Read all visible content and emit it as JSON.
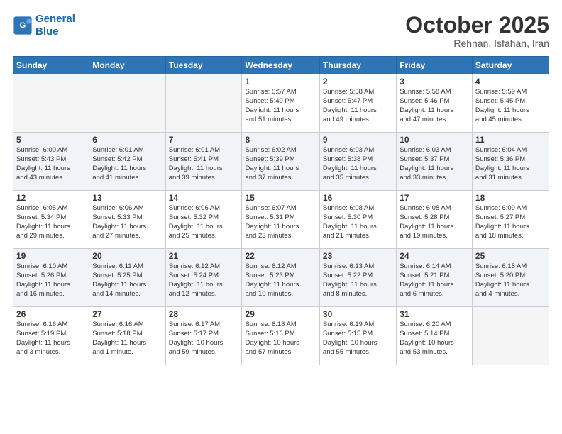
{
  "header": {
    "logo_line1": "General",
    "logo_line2": "Blue",
    "month": "October 2025",
    "location": "Rehnan, Isfahan, Iran"
  },
  "weekdays": [
    "Sunday",
    "Monday",
    "Tuesday",
    "Wednesday",
    "Thursday",
    "Friday",
    "Saturday"
  ],
  "weeks": [
    [
      {
        "day": "",
        "info": ""
      },
      {
        "day": "",
        "info": ""
      },
      {
        "day": "",
        "info": ""
      },
      {
        "day": "1",
        "info": "Sunrise: 5:57 AM\nSunset: 5:49 PM\nDaylight: 11 hours\nand 51 minutes."
      },
      {
        "day": "2",
        "info": "Sunrise: 5:58 AM\nSunset: 5:47 PM\nDaylight: 11 hours\nand 49 minutes."
      },
      {
        "day": "3",
        "info": "Sunrise: 5:58 AM\nSunset: 5:46 PM\nDaylight: 11 hours\nand 47 minutes."
      },
      {
        "day": "4",
        "info": "Sunrise: 5:59 AM\nSunset: 5:45 PM\nDaylight: 11 hours\nand 45 minutes."
      }
    ],
    [
      {
        "day": "5",
        "info": "Sunrise: 6:00 AM\nSunset: 5:43 PM\nDaylight: 11 hours\nand 43 minutes."
      },
      {
        "day": "6",
        "info": "Sunrise: 6:01 AM\nSunset: 5:42 PM\nDaylight: 11 hours\nand 41 minutes."
      },
      {
        "day": "7",
        "info": "Sunrise: 6:01 AM\nSunset: 5:41 PM\nDaylight: 11 hours\nand 39 minutes."
      },
      {
        "day": "8",
        "info": "Sunrise: 6:02 AM\nSunset: 5:39 PM\nDaylight: 11 hours\nand 37 minutes."
      },
      {
        "day": "9",
        "info": "Sunrise: 6:03 AM\nSunset: 5:38 PM\nDaylight: 11 hours\nand 35 minutes."
      },
      {
        "day": "10",
        "info": "Sunrise: 6:03 AM\nSunset: 5:37 PM\nDaylight: 11 hours\nand 33 minutes."
      },
      {
        "day": "11",
        "info": "Sunrise: 6:04 AM\nSunset: 5:36 PM\nDaylight: 11 hours\nand 31 minutes."
      }
    ],
    [
      {
        "day": "12",
        "info": "Sunrise: 6:05 AM\nSunset: 5:34 PM\nDaylight: 11 hours\nand 29 minutes."
      },
      {
        "day": "13",
        "info": "Sunrise: 6:06 AM\nSunset: 5:33 PM\nDaylight: 11 hours\nand 27 minutes."
      },
      {
        "day": "14",
        "info": "Sunrise: 6:06 AM\nSunset: 5:32 PM\nDaylight: 11 hours\nand 25 minutes."
      },
      {
        "day": "15",
        "info": "Sunrise: 6:07 AM\nSunset: 5:31 PM\nDaylight: 11 hours\nand 23 minutes."
      },
      {
        "day": "16",
        "info": "Sunrise: 6:08 AM\nSunset: 5:30 PM\nDaylight: 11 hours\nand 21 minutes."
      },
      {
        "day": "17",
        "info": "Sunrise: 6:08 AM\nSunset: 5:28 PM\nDaylight: 11 hours\nand 19 minutes."
      },
      {
        "day": "18",
        "info": "Sunrise: 6:09 AM\nSunset: 5:27 PM\nDaylight: 11 hours\nand 18 minutes."
      }
    ],
    [
      {
        "day": "19",
        "info": "Sunrise: 6:10 AM\nSunset: 5:26 PM\nDaylight: 11 hours\nand 16 minutes."
      },
      {
        "day": "20",
        "info": "Sunrise: 6:11 AM\nSunset: 5:25 PM\nDaylight: 11 hours\nand 14 minutes."
      },
      {
        "day": "21",
        "info": "Sunrise: 6:12 AM\nSunset: 5:24 PM\nDaylight: 11 hours\nand 12 minutes."
      },
      {
        "day": "22",
        "info": "Sunrise: 6:12 AM\nSunset: 5:23 PM\nDaylight: 11 hours\nand 10 minutes."
      },
      {
        "day": "23",
        "info": "Sunrise: 6:13 AM\nSunset: 5:22 PM\nDaylight: 11 hours\nand 8 minutes."
      },
      {
        "day": "24",
        "info": "Sunrise: 6:14 AM\nSunset: 5:21 PM\nDaylight: 11 hours\nand 6 minutes."
      },
      {
        "day": "25",
        "info": "Sunrise: 6:15 AM\nSunset: 5:20 PM\nDaylight: 11 hours\nand 4 minutes."
      }
    ],
    [
      {
        "day": "26",
        "info": "Sunrise: 6:16 AM\nSunset: 5:19 PM\nDaylight: 11 hours\nand 3 minutes."
      },
      {
        "day": "27",
        "info": "Sunrise: 6:16 AM\nSunset: 5:18 PM\nDaylight: 11 hours\nand 1 minute."
      },
      {
        "day": "28",
        "info": "Sunrise: 6:17 AM\nSunset: 5:17 PM\nDaylight: 10 hours\nand 59 minutes."
      },
      {
        "day": "29",
        "info": "Sunrise: 6:18 AM\nSunset: 5:16 PM\nDaylight: 10 hours\nand 57 minutes."
      },
      {
        "day": "30",
        "info": "Sunrise: 6:19 AM\nSunset: 5:15 PM\nDaylight: 10 hours\nand 55 minutes."
      },
      {
        "day": "31",
        "info": "Sunrise: 6:20 AM\nSunset: 5:14 PM\nDaylight: 10 hours\nand 53 minutes."
      },
      {
        "day": "",
        "info": ""
      }
    ]
  ]
}
